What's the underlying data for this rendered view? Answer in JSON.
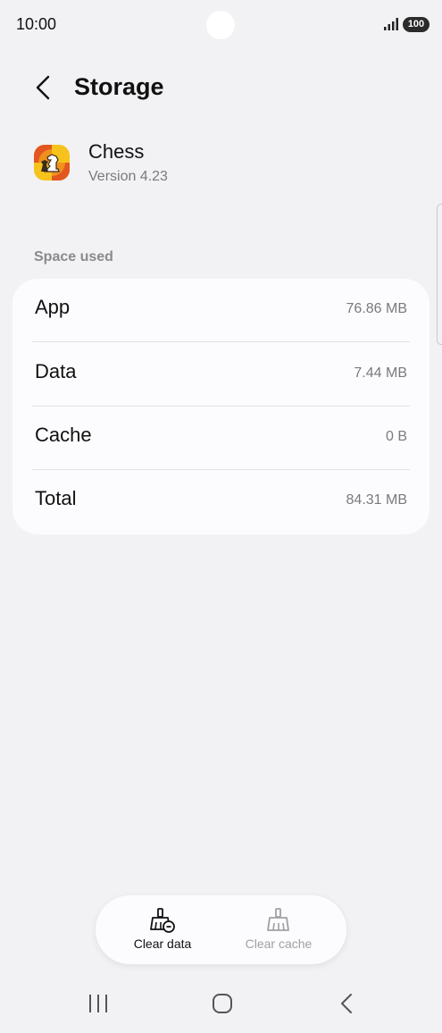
{
  "status_bar": {
    "time": "10:00",
    "battery": "100",
    "icons": [
      "signal-icon",
      "battery-icon"
    ]
  },
  "header": {
    "title": "Storage",
    "back_icon": "chevron-left-icon"
  },
  "app": {
    "name": "Chess",
    "version": "Version 4.23",
    "icon": "chess-app-icon"
  },
  "space_used": {
    "header": "Space used",
    "rows": [
      {
        "label": "App",
        "value": "76.86 MB"
      },
      {
        "label": "Data",
        "value": "7.44 MB"
      },
      {
        "label": "Cache",
        "value": "0 B"
      },
      {
        "label": "Total",
        "value": "84.31 MB"
      }
    ]
  },
  "actions": {
    "clear_data": {
      "label": "Clear data",
      "icon": "broom-clear-data-icon",
      "enabled": true
    },
    "clear_cache": {
      "label": "Clear cache",
      "icon": "broom-icon",
      "enabled": false
    }
  },
  "nav": {
    "recents_icon": "recents-icon",
    "home_icon": "home-icon",
    "back_icon": "back-icon"
  },
  "colors": {
    "background": "#f2f2f4",
    "card": "#fcfcfe",
    "secondary_text": "#7a7a7e",
    "disabled_text": "#a0a0a4"
  }
}
